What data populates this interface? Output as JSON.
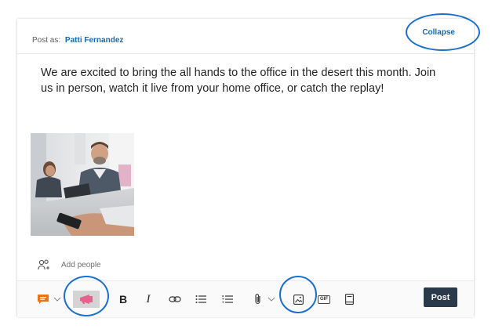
{
  "composer": {
    "post_as_label": "Post as:",
    "author": "Patti Fernandez",
    "collapse_label": "Collapse",
    "message": "We are excited to bring the all hands to the office in the desert this month. Join us in person, watch it live from your home office, or catch the replay!",
    "add_people_label": "Add people"
  },
  "toolbar": {
    "items": [
      {
        "icon": "message-type-icon"
      },
      {
        "icon": "chevron-down-icon"
      },
      {
        "icon": "announcement-icon"
      },
      {
        "icon": "bold-icon",
        "label": "B"
      },
      {
        "icon": "italic-icon",
        "label": "I"
      },
      {
        "icon": "link-icon"
      },
      {
        "icon": "bulleted-list-icon"
      },
      {
        "icon": "numbered-list-icon"
      },
      {
        "icon": "attach-icon"
      },
      {
        "icon": "chevron-down-icon"
      },
      {
        "icon": "image-icon"
      },
      {
        "icon": "gif-icon",
        "label": "GIF"
      },
      {
        "icon": "book-icon"
      }
    ],
    "post_label": "Post"
  },
  "colors": {
    "accent": "#0f6cbd",
    "highlight_circle": "#1a6fd0",
    "post_button": "#2b3a4a",
    "message_type": "#e8751a",
    "announcement": "#e8618c"
  }
}
